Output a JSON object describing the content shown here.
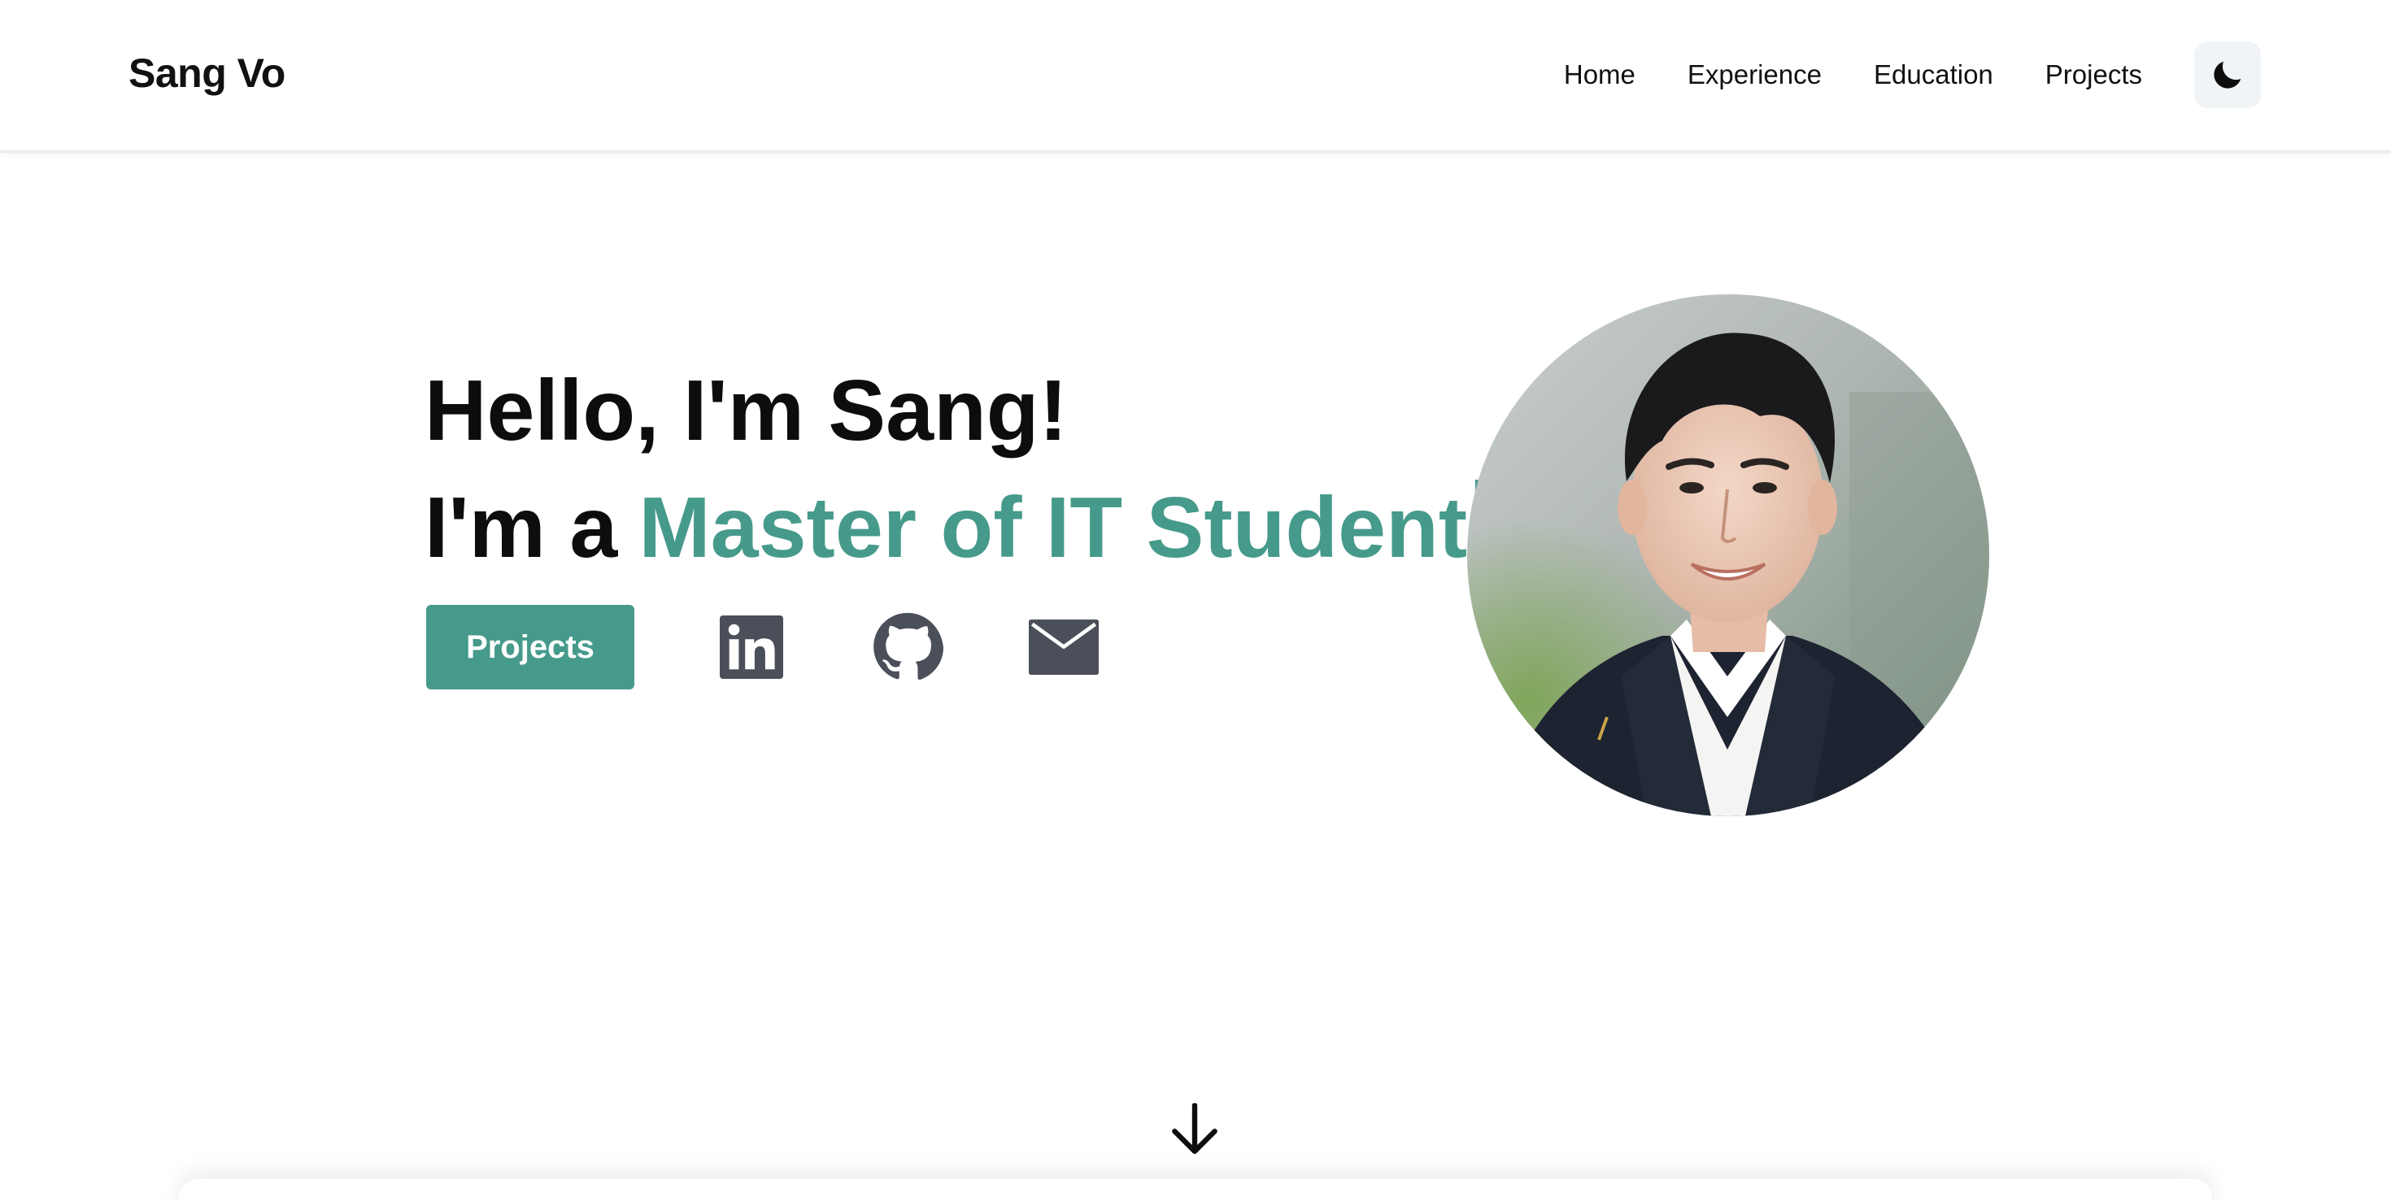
{
  "header": {
    "brand": "Sang Vo",
    "nav": [
      "Home",
      "Experience",
      "Education",
      "Projects"
    ],
    "theme_toggle_icon": "moon-icon"
  },
  "hero": {
    "greeting": "Hello, I'm Sang!",
    "prefix": "I'm a",
    "role": "Master of IT Student",
    "projects_button": "Projects",
    "socials": [
      "linkedin-icon",
      "github-icon",
      "mail-icon"
    ],
    "photo": "profile-photo",
    "scroll_icon": "arrow-down-icon"
  },
  "colors": {
    "accent": "#469a8b",
    "icon_gray": "#4b4f5a",
    "text": "#111111",
    "toggle_bg": "#f1f4f7"
  }
}
